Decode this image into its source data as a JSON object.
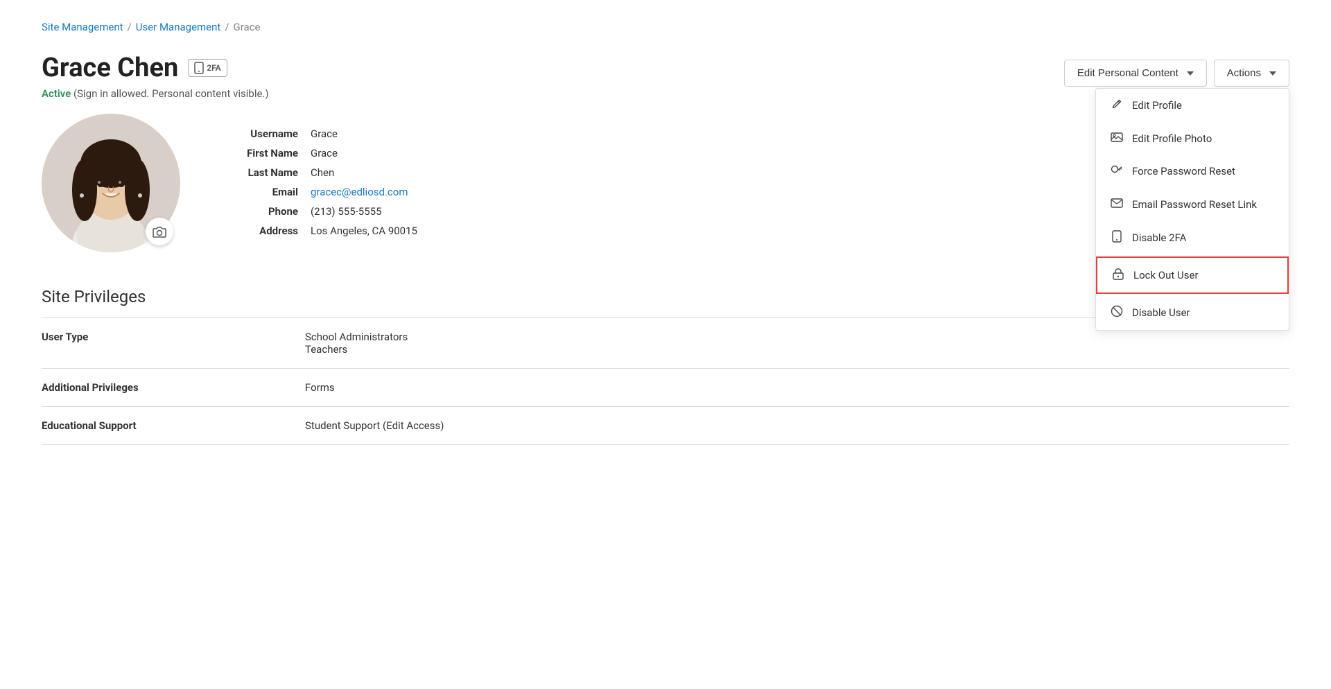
{
  "breadcrumb": {
    "site_management": "Site Management",
    "user_management": "User Management",
    "current": "Grace"
  },
  "user": {
    "name": "Grace Chen",
    "badge": "2FA",
    "status": "Active",
    "status_detail": " (Sign in allowed. Personal content visible.)"
  },
  "buttons": {
    "edit_personal_content": "Edit Personal Content",
    "actions": "Actions"
  },
  "profile": {
    "username_label": "Username",
    "username_value": "Grace",
    "firstname_label": "First Name",
    "firstname_value": "Grace",
    "lastname_label": "Last Name",
    "lastname_value": "Chen",
    "email_label": "Email",
    "email_value": "gracec@edliosd.com",
    "phone_label": "Phone",
    "phone_value": "(213) 555-5555",
    "address_label": "Address",
    "address_value": "Los Angeles, CA 90015"
  },
  "actions_menu": {
    "items": [
      {
        "id": "edit-profile",
        "label": "Edit Profile",
        "icon": "pencil"
      },
      {
        "id": "edit-profile-photo",
        "label": "Edit Profile Photo",
        "icon": "image"
      },
      {
        "id": "force-password-reset",
        "label": "Force Password Reset",
        "icon": "key"
      },
      {
        "id": "email-password-reset",
        "label": "Email Password Reset Link",
        "icon": "envelope"
      },
      {
        "id": "disable-2fa",
        "label": "Disable 2FA",
        "icon": "mobile"
      },
      {
        "id": "lock-out-user",
        "label": "Lock Out User",
        "icon": "lock",
        "highlighted": true
      },
      {
        "id": "disable-user",
        "label": "Disable User",
        "icon": "ban"
      }
    ]
  },
  "privileges": {
    "title": "Site Privileges",
    "rows": [
      {
        "label": "User Type",
        "value": "School Administrators\nTeachers"
      },
      {
        "label": "Additional Privileges",
        "value": "Forms"
      },
      {
        "label": "Educational Support",
        "value": "Student Support (Edit Access)"
      }
    ]
  }
}
